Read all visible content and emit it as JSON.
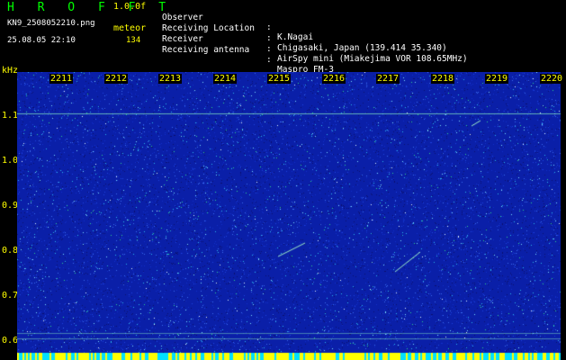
{
  "header": {
    "logo": "H R O F F T",
    "version": "1.0.0f",
    "filename": "KN9_2508052210.png",
    "mode": "meteor",
    "timestamp": "25.08.05 22:10",
    "count": "134"
  },
  "meta": [
    {
      "key": "Observer",
      "value": "K.Nagai"
    },
    {
      "key": "Receiving Location",
      "value": "Chigasaki, Japan (139.414 35.340)"
    },
    {
      "key": "Receiver",
      "value": "AirSpy mini (Miakejima VOR 108.65MHz)"
    },
    {
      "key": "Receiving antenna",
      "value": "Maspro FM-3"
    }
  ],
  "separator": ":",
  "axis": {
    "y_unit": "kHz",
    "y_ticks": [
      "1.1",
      "1.0",
      "0.9",
      "0.8",
      "0.7",
      "0.6"
    ],
    "time_labels": [
      "2211",
      "2212",
      "2213",
      "2214",
      "2215",
      "2216",
      "2217",
      "2218",
      "2219",
      "2220"
    ]
  },
  "colors": {
    "background": "#000000",
    "waterfall_base": "#0a1fa8",
    "label_yellow": "#ffff00",
    "logo_green": "#00ff00",
    "carrier_line": "#7fe0c0"
  }
}
